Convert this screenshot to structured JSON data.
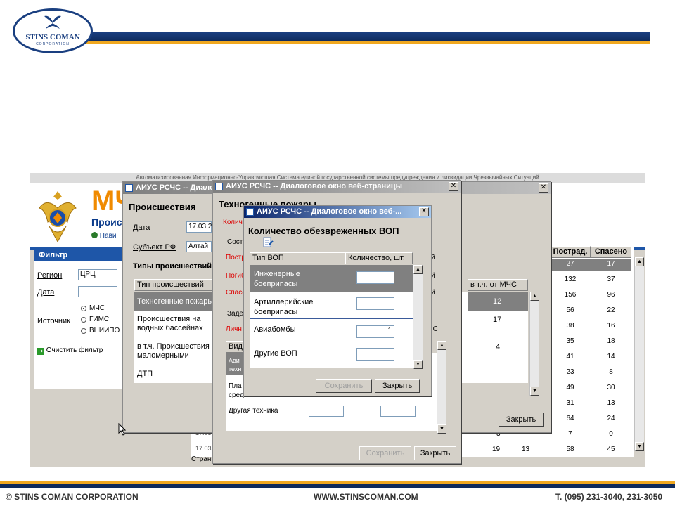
{
  "branding": {
    "logo_text": "STINS COMAN",
    "logo_sub": "CORPORATION",
    "footer_left": "© STINS COMAN CORPORATION",
    "footer_center": "WWW.STINSCOMAN.COM",
    "footer_right": "T. (095) 231-3040, 231-3050"
  },
  "app": {
    "title_strip": "Автоматизированная Информационно-Управляющая Система единой государственной системы предупреждения и ликвидации Чрезвычайных Ситуаций",
    "brand": "МЧС",
    "page_title": "Происш",
    "nav_link": "Нави"
  },
  "filter": {
    "title": "Фильтр",
    "region_label": "Регион",
    "region_value": "ЦРЦ",
    "date_label": "Дата",
    "source_label": "Источник",
    "sources": [
      "МЧС",
      "ГИМС",
      "ВНИИПО"
    ],
    "clear": "Очистить фильтр"
  },
  "grid": {
    "headers": [
      "Пострад.",
      "Спасено"
    ],
    "rows": [
      [
        "27",
        "17"
      ],
      [
        "132",
        "37"
      ],
      [
        "156",
        "96"
      ],
      [
        "56",
        "22"
      ],
      [
        "38",
        "16"
      ],
      [
        "35",
        "18"
      ],
      [
        "41",
        "14"
      ],
      [
        "23",
        "8"
      ],
      [
        "49",
        "30"
      ],
      [
        "31",
        "13"
      ],
      [
        "64",
        "24"
      ],
      [
        "7",
        "0"
      ],
      [
        "58",
        "45"
      ]
    ],
    "bottom_left": [
      "17.03",
      "17.03"
    ],
    "bottom_mid": [
      "3",
      "19",
      "13"
    ],
    "status": "Стран"
  },
  "dialog1": {
    "title": "АИУС РСЧС -- Диало",
    "heading": "Происшествия",
    "date_label": "Дата",
    "date_value": "17.03.2",
    "subject_label": "Субъект РФ",
    "subject_value": "Алтай",
    "types_heading": "Типы происшествий",
    "col_type": "Тип происшествий",
    "col_mchs": "в т.ч. от МЧС",
    "rows": [
      {
        "label": "Техногенные пожары",
        "mchs": "12"
      },
      {
        "label": "Происшествия на водных бассейнах",
        "mchs": "17"
      },
      {
        "label": "в т.ч. Происшествия с маломерными судами",
        "mchs": "4"
      },
      {
        "label": "ДТП",
        "mchs": ""
      }
    ],
    "close": "Закрыть"
  },
  "dialog2": {
    "title": "АИУС РСЧС -- Диалоговое окно веб-страницы",
    "heading": "Техногенные пожары",
    "count_label": "Количе",
    "section1": "Сост",
    "red_labels": [
      "Постр",
      "Погиб",
      "Спасе"
    ],
    "section2": "Заде",
    "personnel": "Личн",
    "view_label": "Вид",
    "row_av": "Ави техн",
    "row_pla": "Пла сред",
    "row_other": "Другая техника",
    "side_labels": [
      "й",
      "й",
      "й"
    ],
    "mchs_short": "ЧС",
    "save": "Сохранить",
    "close": "Закрыть"
  },
  "dialog3": {
    "title": "АИУС РСЧС -- Диалоговое окно веб-...",
    "heading": "Количество обезвреженных ВОП",
    "col_type": "Тип ВОП",
    "col_count": "Количество, шт.",
    "rows": [
      {
        "label": "Инженерные боеприпасы",
        "value": ""
      },
      {
        "label": "Артиллерийские боеприпасы",
        "value": ""
      },
      {
        "label": "Авиабомбы",
        "value": "1"
      },
      {
        "label": "Другие ВОП",
        "value": ""
      }
    ],
    "save": "Сохранить",
    "close": "Закрыть"
  }
}
